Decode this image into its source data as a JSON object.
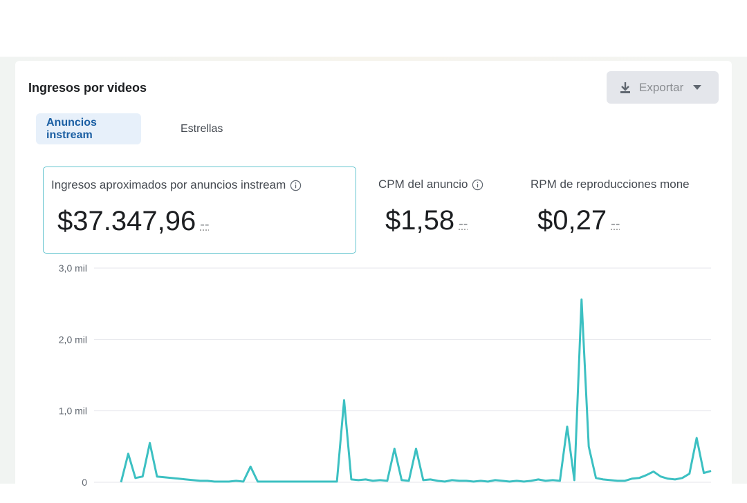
{
  "card": {
    "title": "Ingresos por videos",
    "export_label": "Exportar"
  },
  "tabs": [
    {
      "label": "Anuncios instream",
      "active": true
    },
    {
      "label": "Estrellas",
      "active": false
    }
  ],
  "metrics": [
    {
      "label": "Ingresos aproximados por anuncios instream",
      "value": "$37.347,96",
      "delta": "--",
      "selected": true
    },
    {
      "label": "CPM del anuncio",
      "value": "$1,58",
      "delta": "--",
      "selected": false
    },
    {
      "label": "RPM de reproducciones mone",
      "value": "$0,27",
      "delta": "--",
      "selected": false
    }
  ],
  "colors": {
    "accent": "#3cc0c2",
    "tab_active_bg": "#e7f0fa",
    "tab_active_text": "#1b5fa3",
    "selected_border": "#63c4cf"
  },
  "chart_data": {
    "type": "line",
    "series": [
      {
        "values": [
          0,
          400,
          60,
          80,
          550,
          80,
          70,
          60,
          50,
          40,
          30,
          20,
          20,
          10,
          10,
          10,
          20,
          10,
          220,
          10,
          10,
          10,
          10,
          10,
          10,
          10,
          10,
          10,
          10,
          10,
          10,
          1150,
          40,
          30,
          40,
          20,
          30,
          20,
          470,
          30,
          20,
          470,
          30,
          40,
          20,
          10,
          30,
          20,
          20,
          10,
          20,
          10,
          30,
          20,
          10,
          20,
          10,
          20,
          40,
          20,
          30,
          20,
          780,
          30,
          2560,
          500,
          60,
          40,
          30,
          20,
          20,
          50,
          60,
          100,
          150,
          80,
          50,
          40,
          60,
          120,
          620,
          130,
          160
        ]
      }
    ],
    "yticks": [
      "3,0 mil",
      "2,0 mil",
      "1,0 mil",
      "0"
    ],
    "ylim": [
      0,
      3000
    ],
    "grid": true
  }
}
